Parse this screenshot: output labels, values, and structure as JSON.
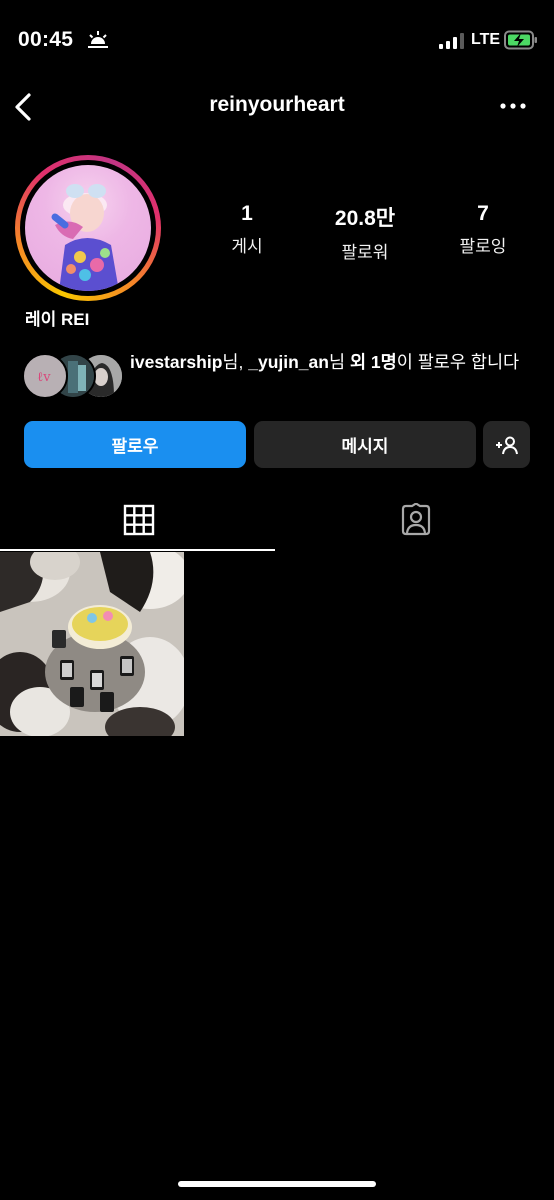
{
  "status_bar": {
    "time": "00:45",
    "network": "LTE"
  },
  "header": {
    "username": "reinyourheart"
  },
  "profile": {
    "display_name": "레이 REI",
    "stats": [
      {
        "value": "1",
        "label": "게시"
      },
      {
        "value": "20.8만",
        "label": "팔로워"
      },
      {
        "value": "7",
        "label": "팔로잉"
      }
    ]
  },
  "mutual": {
    "user1": "ivestarship",
    "suffix1": "님, ",
    "user2": "_yujin_an",
    "suffix2": "님 ",
    "others": "외 1명",
    "tail": "이 팔로우 합니다"
  },
  "actions": {
    "follow_label": "팔로우",
    "message_label": "메시지"
  },
  "icons": {
    "back": "chevron-left-icon",
    "more": "more-horizontal-icon",
    "grid": "grid-icon",
    "tagged": "tagged-person-icon",
    "suggest": "add-person-icon"
  },
  "colors": {
    "follow_button": "#1a8ff0",
    "secondary_button": "#262626",
    "battery_charging": "#4cd964"
  }
}
